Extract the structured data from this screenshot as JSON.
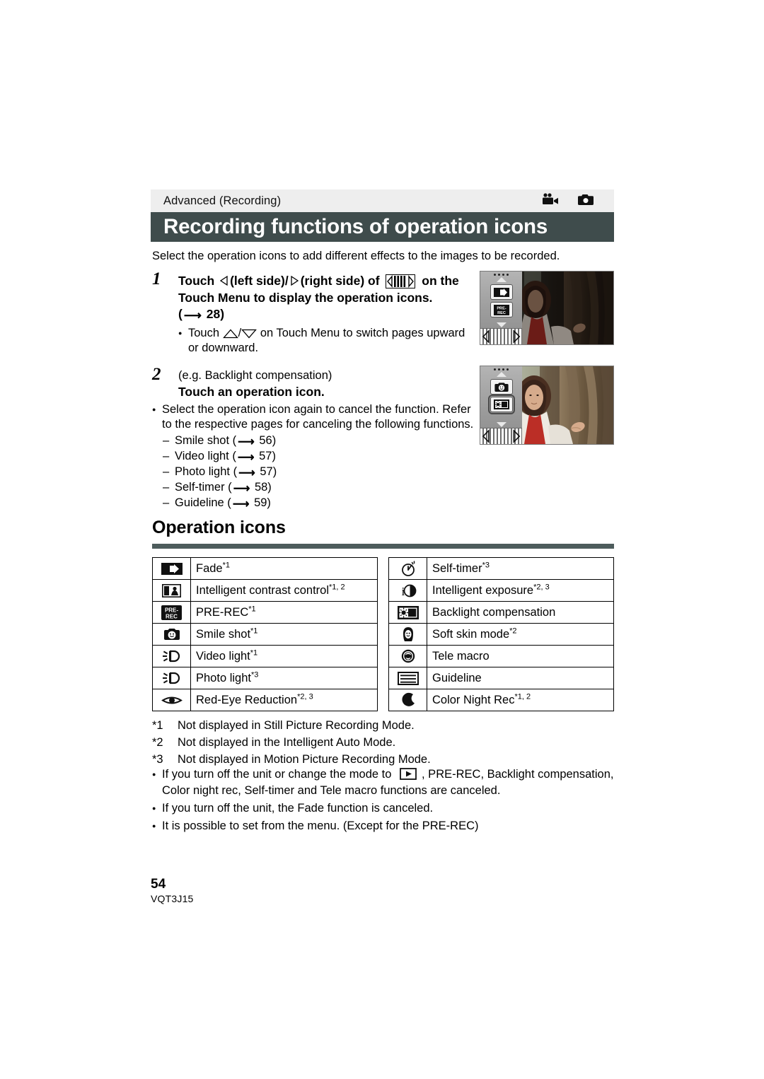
{
  "header": {
    "chapter": "Advanced (Recording)",
    "title": "Recording functions of operation icons",
    "icons": [
      "camcorder-icon",
      "still-camera-icon"
    ],
    "bar_color": "#3f4c4c",
    "chapter_bg": "#eeeeee"
  },
  "intro": "Select the operation icons to add different effects to the images to be recorded.",
  "steps": [
    {
      "number": "1",
      "head_part1": "Touch",
      "head_left": "(left side)/",
      "head_right": "(right side) of",
      "head_part2": "on the",
      "head_line2": "Touch Menu to display the operation icons.",
      "ref": "28",
      "bullet_pre": "Touch",
      "bullet_post": "on Touch Menu to switch pages upward or downward."
    },
    {
      "number": "2",
      "eg": "(e.g. Backlight compensation)",
      "head": "Touch an operation icon.",
      "bullet": "Select the operation icon again to cancel the function. Refer to the respective pages for canceling the following functions.",
      "cancel_list": [
        {
          "label": "Smile shot",
          "page": "56"
        },
        {
          "label": "Video light",
          "page": "57"
        },
        {
          "label": "Photo light",
          "page": "57"
        },
        {
          "label": "Self-timer",
          "page": "58"
        },
        {
          "label": "Guideline",
          "page": "59"
        }
      ]
    }
  ],
  "photos": [
    {
      "caption_name": "lcd-screenshot-fade-prerec",
      "menu_icons": [
        "fade-icon",
        "pre-rec-icon"
      ],
      "selected_index": -1
    },
    {
      "caption_name": "lcd-screenshot-backlight-selected",
      "menu_icons": [
        "smile-shot-icon",
        "backlight-compensation-icon"
      ],
      "selected_index": 1
    }
  ],
  "section": {
    "title": "Operation icons",
    "rule_color": "#4d5c5c"
  },
  "table": {
    "left_column": [
      {
        "icon": "fade-icon",
        "label": "Fade",
        "sup": "*1"
      },
      {
        "icon": "intelligent-contrast-control-icon",
        "label": "Intelligent contrast control",
        "sup": "*1, 2"
      },
      {
        "icon": "pre-rec-icon",
        "label": "PRE-REC",
        "sup": "*1"
      },
      {
        "icon": "smile-shot-icon",
        "label": "Smile shot",
        "sup": "*1"
      },
      {
        "icon": "video-light-icon",
        "label": "Video light",
        "sup": "*1"
      },
      {
        "icon": "photo-light-icon",
        "label": "Photo light",
        "sup": "*3"
      },
      {
        "icon": "red-eye-reduction-icon",
        "label": "Red-Eye Reduction",
        "sup": "*2, 3"
      }
    ],
    "right_column": [
      {
        "icon": "self-timer-icon",
        "label": "Self-timer",
        "sup": "*3"
      },
      {
        "icon": "intelligent-exposure-icon",
        "label": "Intelligent exposure",
        "sup": "*2, 3"
      },
      {
        "icon": "backlight-compensation-icon",
        "label": "Backlight compensation",
        "sup": ""
      },
      {
        "icon": "soft-skin-mode-icon",
        "label": "Soft skin mode",
        "sup": "*2"
      },
      {
        "icon": "tele-macro-icon",
        "label": "Tele macro",
        "sup": ""
      },
      {
        "icon": "guideline-icon",
        "label": "Guideline",
        "sup": ""
      },
      {
        "icon": "color-night-rec-icon",
        "label": "Color Night Rec",
        "sup": "*1, 2"
      }
    ]
  },
  "footnotes": [
    {
      "mark": "*1",
      "text": "Not displayed in Still Picture Recording Mode."
    },
    {
      "mark": "*2",
      "text": "Not displayed in the Intelligent Auto Mode."
    },
    {
      "mark": "*3",
      "text": "Not displayed in Motion Picture Recording Mode."
    }
  ],
  "notes": {
    "note1_pre": "If you turn off the unit or change the mode to",
    "note1_post": ", PRE-REC, Backlight compensation, Color night rec, Self-timer and Tele macro functions are canceled.",
    "note2": "If you turn off the unit, the Fade function is canceled.",
    "note3": "It is possible to set from the menu. (Except for the PRE-REC)"
  },
  "footer": {
    "page_number": "54",
    "document_code": "VQT3J15"
  }
}
